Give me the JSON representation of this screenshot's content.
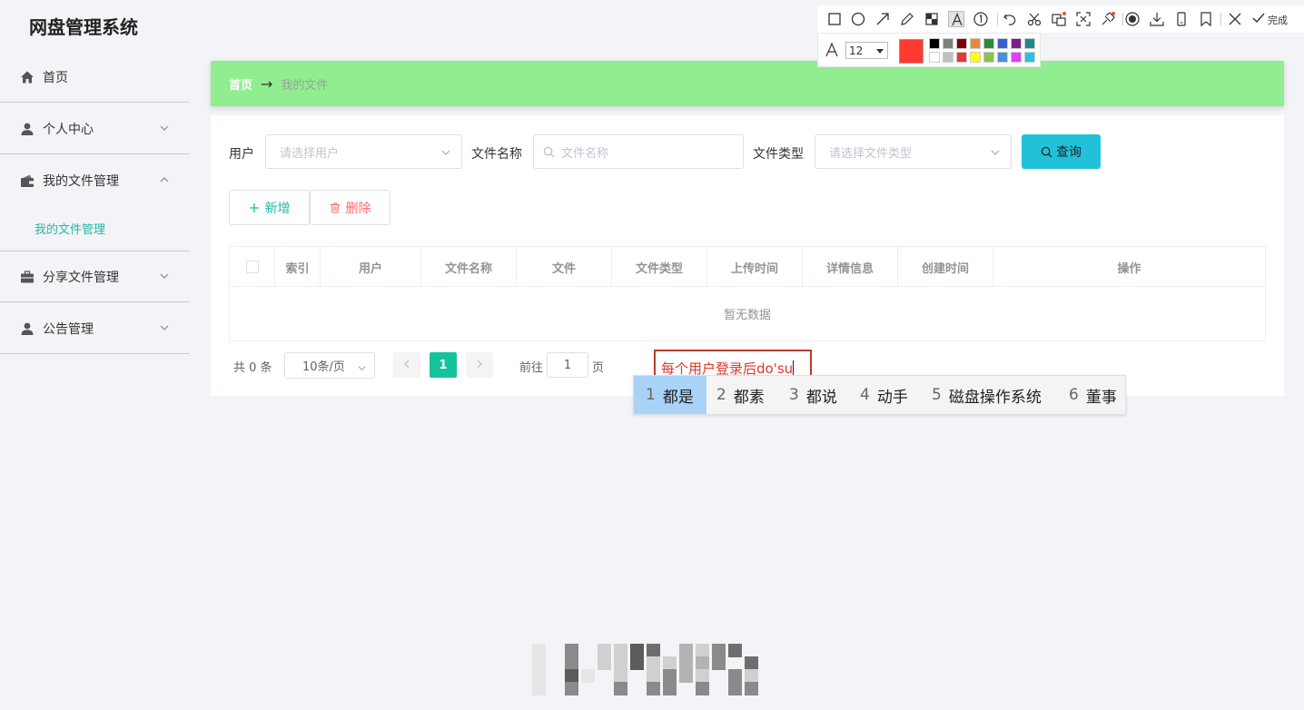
{
  "app": {
    "title": "网盘管理系统"
  },
  "sidebar": {
    "items": [
      {
        "label": "首页",
        "icon": "home-icon",
        "expandable": false
      },
      {
        "label": "个人中心",
        "icon": "user-icon",
        "expandable": true,
        "expanded": false
      },
      {
        "label": "我的文件管理",
        "icon": "wallet-icon",
        "expandable": true,
        "expanded": true
      },
      {
        "label": "分享文件管理",
        "icon": "briefcase-icon",
        "expandable": true,
        "expanded": false
      },
      {
        "label": "公告管理",
        "icon": "user-icon",
        "expandable": true,
        "expanded": false
      }
    ],
    "submenu": {
      "label": "我的文件管理"
    }
  },
  "breadcrumb": {
    "home": "首页",
    "arrow": "→",
    "current": "我的文件"
  },
  "filters": {
    "user_label": "用户",
    "user_placeholder": "请选择用户",
    "filename_label": "文件名称",
    "filename_placeholder": "文件名称",
    "filetype_label": "文件类型",
    "filetype_placeholder": "请选择文件类型",
    "query_button": "查询"
  },
  "actions": {
    "add": "新增",
    "delete": "删除"
  },
  "table": {
    "columns": [
      "索引",
      "用户",
      "文件名称",
      "文件",
      "文件类型",
      "上传时间",
      "详情信息",
      "创建时间",
      "操作"
    ],
    "empty_text": "暂无数据"
  },
  "pagination": {
    "total_text": "共 0 条",
    "page_size": "10条/页",
    "current_page": "1",
    "goto_label": "前往",
    "goto_value": "1",
    "page_unit": "页"
  },
  "annotation_toolbar": {
    "tools": [
      "rectangle-icon",
      "ellipse-icon",
      "arrow-icon",
      "pencil-icon",
      "mosaic-icon",
      "text-icon",
      "number-icon",
      "undo-icon",
      "cut-icon",
      "ocr-icon",
      "capture-icon",
      "pin-icon",
      "record-icon",
      "download-icon",
      "mobile-icon",
      "bookmark-icon",
      "close-icon"
    ],
    "done_label": "完成",
    "font_size": "12",
    "current_color": "#ff3b30",
    "palette_top": [
      "#000000",
      "#808080",
      "#800000",
      "#e8873a",
      "#2e8b3a",
      "#3a5fcd",
      "#7b1f8a",
      "#1f8a8a"
    ],
    "palette_bottom": [
      "#ffffff",
      "#c0c0c0",
      "#e53935",
      "#ffff00",
      "#8bc34a",
      "#4a90d9",
      "#e040fb",
      "#26c6da"
    ]
  },
  "text_annotation": {
    "value": "每个用户登录后do'su"
  },
  "ime": {
    "candidates": [
      {
        "num": "1",
        "text": "都是",
        "selected": true
      },
      {
        "num": "2",
        "text": "都素",
        "selected": false
      },
      {
        "num": "3",
        "text": "都说",
        "selected": false
      },
      {
        "num": "4",
        "text": "动手",
        "selected": false
      },
      {
        "num": "5",
        "text": "磁盘操作系统",
        "selected": false
      },
      {
        "num": "6",
        "text": "董事",
        "selected": false
      }
    ]
  }
}
